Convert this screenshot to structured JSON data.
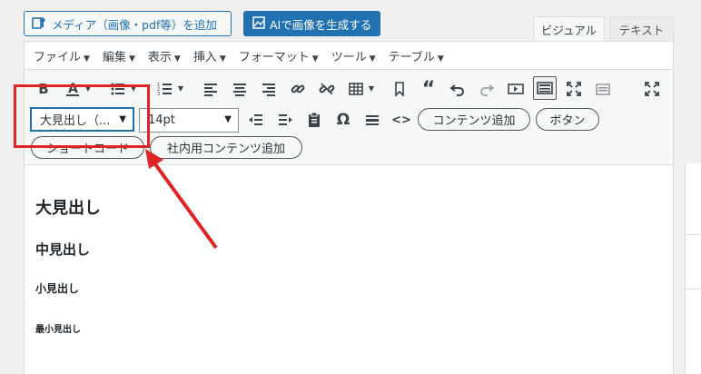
{
  "top_buttons": {
    "add_media": "メディア（画像・pdf等）を追加",
    "ai_generate": "AIで画像を生成する"
  },
  "tabs": [
    {
      "label": "ビジュアル",
      "active": true
    },
    {
      "label": "テキスト",
      "active": false
    }
  ],
  "menubar": [
    "ファイル",
    "編集",
    "表示",
    "挿入",
    "フォーマット",
    "ツール",
    "テーブル"
  ],
  "toolbar": {
    "format_select": "大見出し（...",
    "font_size_select": "14pt",
    "pill_buttons": [
      "コンテンツ追加",
      "ボタン",
      "ショートコード",
      "社内用コンテンツ追加"
    ]
  },
  "content": {
    "heading_large": "大見出し",
    "heading_mid": "中見出し",
    "heading_small": "小見出し",
    "heading_min": "最小見出し"
  },
  "annotation_color": "#e02424",
  "accent_color": "#2271b1"
}
